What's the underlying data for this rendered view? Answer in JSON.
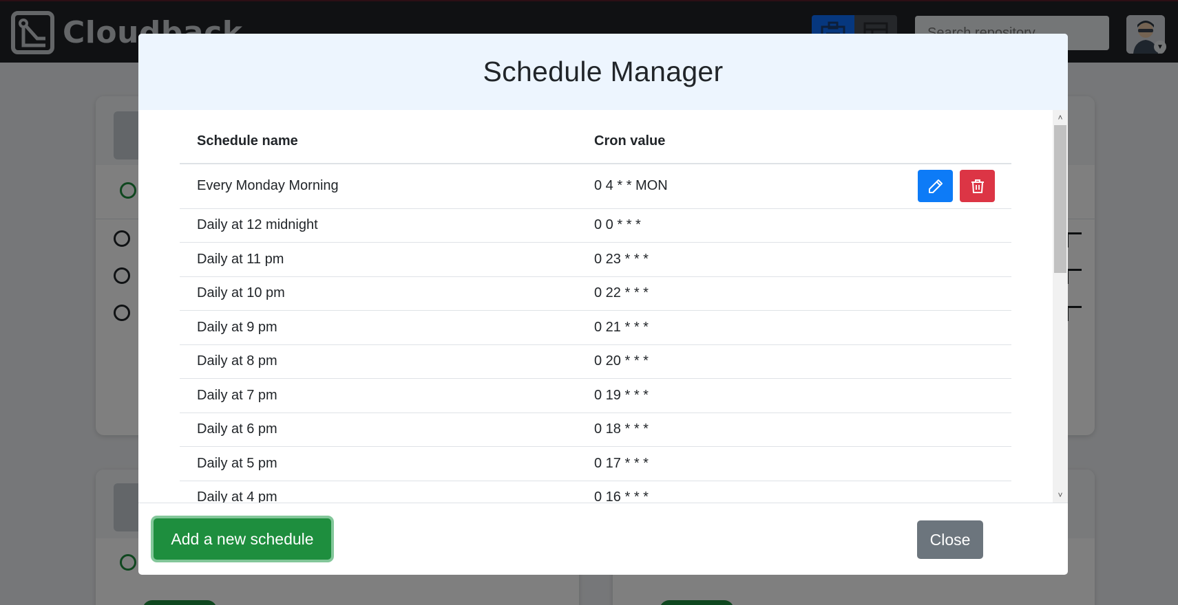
{
  "app": {
    "brand": "Cloudback",
    "search_placeholder": "Search repository"
  },
  "modal": {
    "title": "Schedule Manager",
    "columns": {
      "name": "Schedule name",
      "cron": "Cron value"
    },
    "rows": [
      {
        "name": "Every Monday Morning",
        "cron": "0 4 * * MON"
      },
      {
        "name": "Daily at 12 midnight",
        "cron": "0 0 * * *"
      },
      {
        "name": "Daily at 11 pm",
        "cron": "0 23 * * *"
      },
      {
        "name": "Daily at 10 pm",
        "cron": "0 22 * * *"
      },
      {
        "name": "Daily at 9 pm",
        "cron": "0 21 * * *"
      },
      {
        "name": "Daily at 8 pm",
        "cron": "0 20 * * *"
      },
      {
        "name": "Daily at 7 pm",
        "cron": "0 19 * * *"
      },
      {
        "name": "Daily at 6 pm",
        "cron": "0 18 * * *"
      },
      {
        "name": "Daily at 5 pm",
        "cron": "0 17 * * *"
      },
      {
        "name": "Daily at 4 pm",
        "cron": "0 16 * * *"
      }
    ],
    "add_button": "Add a new schedule",
    "close_button": "Close"
  },
  "colors": {
    "header_bg": "#edf5fe",
    "edit_button": "#0d7bf7",
    "delete_button": "#dc3545",
    "add_button": "#1e8e3e",
    "close_button": "#6c757d"
  },
  "icons": {
    "edit": "pencil-icon",
    "delete": "trash-icon",
    "dashboard_view": "dashboard-icon",
    "table_view": "table-icon"
  }
}
